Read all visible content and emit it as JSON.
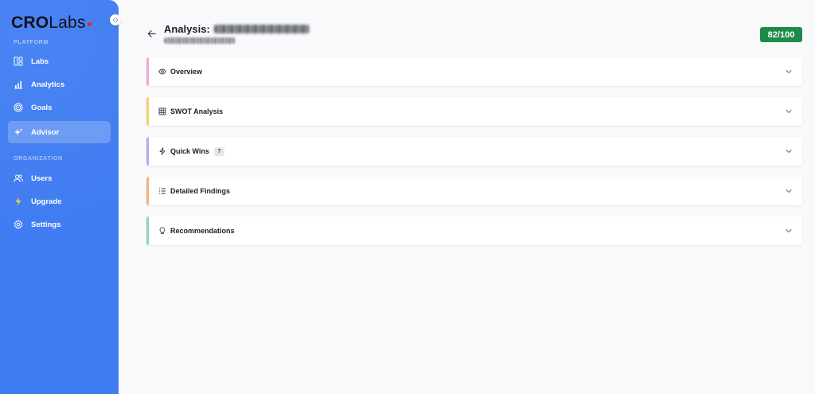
{
  "brand": {
    "logo_bold": "CRO",
    "logo_light": "Labs",
    "dot_color": "#e2262b"
  },
  "sidebar": {
    "background": "#3f7cf2",
    "sections": [
      {
        "label": "PLATFORM"
      },
      {
        "label": "ORGANIZATION"
      }
    ],
    "items": [
      {
        "label": "Labs",
        "icon": "layout-icon"
      },
      {
        "label": "Analytics",
        "icon": "bar-chart-icon"
      },
      {
        "label": "Goals",
        "icon": "target-icon"
      },
      {
        "label": "Advisor",
        "icon": "sparkles-icon",
        "active": true
      },
      {
        "label": "Users",
        "icon": "users-icon"
      },
      {
        "label": "Upgrade",
        "icon": "lightning-icon"
      },
      {
        "label": "Settings",
        "icon": "gear-icon"
      }
    ]
  },
  "header": {
    "title_prefix": "Analysis:",
    "score": "82/100",
    "score_color": "#1e8a4a"
  },
  "panels": [
    {
      "label": "Overview",
      "icon": "eye-icon",
      "accent": "#f3a6cf"
    },
    {
      "label": "SWOT Analysis",
      "icon": "grid-icon",
      "accent": "#f5cf6a"
    },
    {
      "label": "Quick Wins",
      "icon": "lightning-icon",
      "accent": "#b8a8f0",
      "count": "7"
    },
    {
      "label": "Detailed Findings",
      "icon": "list-icon",
      "accent": "#f0b27a"
    },
    {
      "label": "Recommendations",
      "icon": "lightbulb-icon",
      "accent": "#8fd3b6"
    }
  ]
}
